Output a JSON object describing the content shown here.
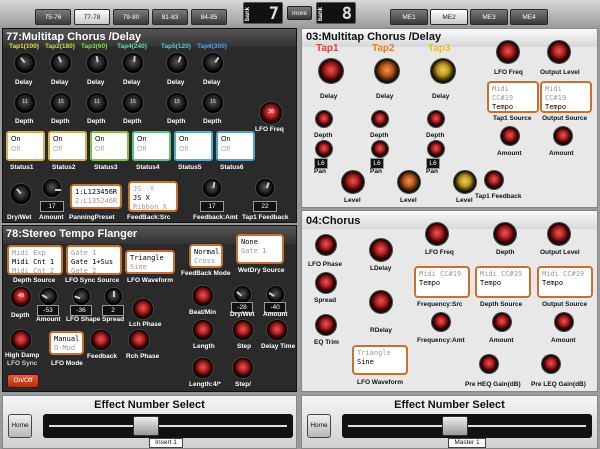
{
  "topbar": {
    "tabs": [
      "75-76",
      "77-78",
      "79-80",
      "81-83",
      "84-85"
    ],
    "selected_tab": "77-78",
    "bank_label": "bank",
    "bank_value": "7",
    "more_label": "more",
    "bank2_label": "bank",
    "bank2_value": "8",
    "me_tabs": [
      "ME1",
      "ME2",
      "ME3",
      "ME4"
    ],
    "selected_me": "ME2"
  },
  "p77": {
    "title": "77:Multitap Chorus /Delay",
    "taps": [
      "Tap1(100)",
      "Tap2(180)",
      "Tap3(60)",
      "Tap4(240)",
      "Tap5(120)",
      "Tap6(300)"
    ],
    "tap_colors": [
      "#e8e040",
      "#c0e040",
      "#80e040",
      "#60e0a0",
      "#50d0e0",
      "#50a0f0"
    ],
    "delay_label": "Delay",
    "depth_label": "Depth",
    "depth_values": [
      "11",
      "15",
      "11",
      "15",
      "15",
      "15"
    ],
    "lfo_freq_label": "LFO Freq",
    "lfo_freq_value": "30",
    "status_on": "On",
    "status_off": "Off",
    "status_labels": [
      "Status1",
      "Status2",
      "Status3",
      "Status4",
      "Status5",
      "Status6"
    ],
    "status_colors": [
      "#d8b050",
      "#d8b050",
      "#80c040",
      "#60c080",
      "#50b0d0",
      "#50a0d0"
    ],
    "drywet_label": "Dry/Wet",
    "amount_label": "Amount",
    "amount_value": "17",
    "panning_lines": [
      "1:L123456R",
      "2:L135246R"
    ],
    "panning_label": "PanningPreset",
    "feedback_lines": [
      "JS -Y",
      "JS X",
      "Ribbon X"
    ],
    "feedback_label": "FeedBack:Src",
    "fbamt_label": "Feedback:Amt",
    "fbamt_value": "17",
    "tapfb_label": "Tap1 Feedback",
    "tapfb_value": "22"
  },
  "p78": {
    "title": "78:Stereo Tempo Flanger",
    "depth_source_lines": [
      "Midi Exp",
      "Midi Cnt 1",
      "Midi Cnt 2"
    ],
    "depth_source_label": "Depth Source",
    "lfo_sync_lines": [
      "Gate 1",
      "Gate 1+Sus",
      "Gate 2"
    ],
    "lfo_sync_label": "LFO Sync Source",
    "lfo_wave_lines": [
      "Triangle",
      "Sine"
    ],
    "lfo_wave_label": "LFO Waveform",
    "fb_mode_lines": [
      "Normal",
      "Cross"
    ],
    "fb_mode_label": "FeedBack Mode",
    "wetdry_lines": [
      "None",
      "Gate 1"
    ],
    "wetdry_label": "WetDry Source",
    "depth_label": "Depth",
    "depth_value": "40",
    "amount_label": "Amount",
    "amount_value": "-53",
    "lfoshape_label": "LFO Shape",
    "lfoshape_value": "-36",
    "spread_label": "Spread",
    "spread_value": "2",
    "lch_label": "Lch Phase",
    "beatmin_label": "Beat/Min",
    "drywet_label": "Dry/Wet",
    "drywet_value": "-28",
    "amount2_label": "Amount",
    "amount2_value": "-40",
    "highdamp_label": "High Damp",
    "lfosync_label": "LFO Sync",
    "lfomode_lines": [
      "Manual",
      "O-Mod"
    ],
    "lfomode_label": "LFO Mode",
    "feedback_label": "Feedback",
    "rch_label": "Rch Phase",
    "length_label": "Length",
    "step_label": "Step",
    "delaytime_label": "Delay Time",
    "length4_label": "Length:4/*",
    "step2_label": "Step/",
    "onoff_label": "On/Off"
  },
  "p03": {
    "title": "03:Multitap Chorus /Delay",
    "taps": [
      "Tap1",
      "Tap2",
      "Tap3"
    ],
    "tap_colors": [
      "#e04030",
      "#e08030",
      "#e8c030"
    ],
    "delay_label": "Delay",
    "depth_label": "Depth",
    "pan_label": "Pan",
    "pan_values": [
      "L6",
      "L6",
      "L6"
    ],
    "level_label": "Level",
    "lfofreq_label": "LFO Freq",
    "output_level_label": "Output Level",
    "tap1_source_lines": [
      "Midi CC#19",
      "Tempo"
    ],
    "tap1_source_label": "Tap1 Source",
    "output_source_lines": [
      "Midi CC#19",
      "Tempo"
    ],
    "output_source_label": "Output Source",
    "amount_label": "Amount",
    "tap1_fb_label": "Tap1 Feedback"
  },
  "p04": {
    "title": "04:Chorus",
    "lfophase_label": "LFO Phase",
    "ldelay_label": "LDelay",
    "lfofreq_label": "LFO Freq",
    "depth_label": "Depth",
    "output_level_label": "Output Level",
    "spread_label": "Spread",
    "freq_src_lines": [
      "Midi CC#19",
      "Tempo"
    ],
    "freq_src_label": "Frequency:Src",
    "depth_src_lines": [
      "Midi CC#19",
      "Tempo"
    ],
    "depth_src_label": "Depth Source",
    "output_src_lines": [
      "Midi CC#19",
      "Tempo"
    ],
    "output_src_label": "Output Source",
    "eqtrim_label": "EQ Trim",
    "rdelay_label": "RDelay",
    "freqamt_label": "Frequency:Amt",
    "amount_label": "Amount",
    "lfowave_lines": [
      "Triangle",
      "Sine"
    ],
    "lfowave_label": "LFO Waveform",
    "prehq_label": "Pre HEQ Gain(dB)",
    "preleq_label": "Pre LEQ Gain(dB)"
  },
  "bottom": {
    "left_title": "Effect Number Select",
    "left_home": "Home",
    "left_tag": "Insert 1",
    "right_title": "Effect Number Select",
    "right_home": "Home",
    "right_tag": "Master 1"
  }
}
